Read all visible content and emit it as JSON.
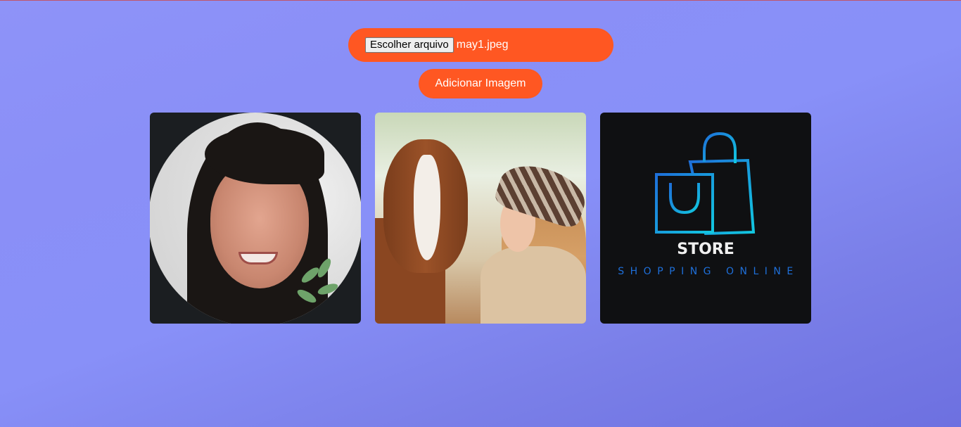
{
  "upload": {
    "choose_button_label": "Escolher arquivo",
    "selected_file": "may1.jpeg"
  },
  "add_button_label": "Adicionar Imagem",
  "gallery": {
    "images": [
      {
        "name": "portrait-photo"
      },
      {
        "name": "horse-and-woman-photo"
      },
      {
        "name": "store-logo",
        "title": "STORE",
        "subtitle": "SHOPPING ONLINE"
      }
    ]
  },
  "colors": {
    "accent": "#ff5722",
    "background_start": "#8e93f8",
    "background_end": "#6d70e0",
    "logo_blue": "#1e6fd9",
    "logo_cyan": "#12c8e0"
  }
}
